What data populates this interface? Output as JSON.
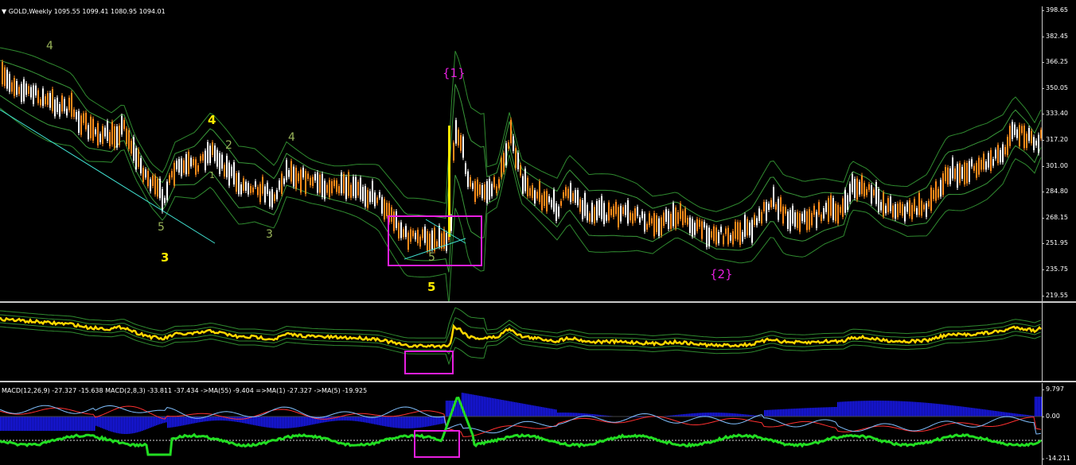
{
  "window": {
    "symbol_header": "GOLD,Weekly  1095.55 1099.41 1080.95 1094.01",
    "macd_header": "MACD(12,26,9) -27.327 -15.638  MACD(2,8,3) -33.811 -37.434  ->MA(55) -9.404  =>MA(1) -27.327  ->MA(5) -19.925"
  },
  "price_axis": [
    "398.65",
    "382.45",
    "366.25",
    "350.05",
    "333.40",
    "317.20",
    "301.00",
    "284.80",
    "268.15",
    "251.95",
    "235.75",
    "219.55"
  ],
  "macd_axis": [
    "9.797",
    "0.00",
    "-14.211"
  ],
  "annotations": {
    "wave_4_top": "4",
    "wave_4_yellow": "4",
    "wave_2": "2",
    "wave_1": "1",
    "wave_4_mid": "4",
    "wave_5_left": "5",
    "wave_3_small": "3",
    "wave_3_yellow": "3",
    "wave_5_box": "5",
    "wave_5_yellow": "5",
    "label_1": "{1}",
    "label_2": "{2}"
  },
  "colors": {
    "background": "#000000",
    "bull_candle": "#ffffff",
    "bear_candle": "#ff8c1a",
    "band_line": "#2f8a2f",
    "trend_line": "#40e0d0",
    "elliott_big": "#ffeb00",
    "elliott_small": "#9ab55a",
    "highlight": "#e81fe0",
    "macd_hist": "#1a1aff",
    "macd_line": "#22dd22"
  }
}
